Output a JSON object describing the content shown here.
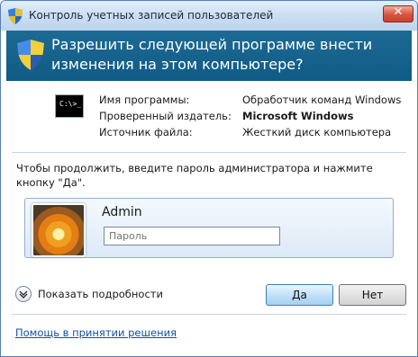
{
  "window": {
    "title": "Контроль учетных записей пользователей",
    "close_glyph": "✕"
  },
  "header": {
    "text": "Разрешить следующей программе внести изменения на этом компьютере?"
  },
  "program_info": {
    "icon": "command-prompt-icon",
    "icon_text": "C:\\>_",
    "labels": [
      "Имя программы:",
      "Проверенный издатель:",
      "Источник файла:"
    ],
    "values": [
      "Обработчик команд Windows",
      "Microsoft Windows",
      "Жесткий диск компьютера"
    ]
  },
  "prompt": "Чтобы продолжить, введите пароль администратора и нажмите кнопку \"Да\".",
  "credentials": {
    "username": "Admin",
    "password_value": "",
    "password_placeholder": "Пароль"
  },
  "details_toggle": "Показать подробности",
  "buttons": {
    "yes": "Да",
    "no": "Нет"
  },
  "help_link": "Помощь в принятии решения",
  "colors": {
    "header_bg": "#13608b",
    "link": "#0f4fa8",
    "titlebar": "#c9ddf1"
  }
}
